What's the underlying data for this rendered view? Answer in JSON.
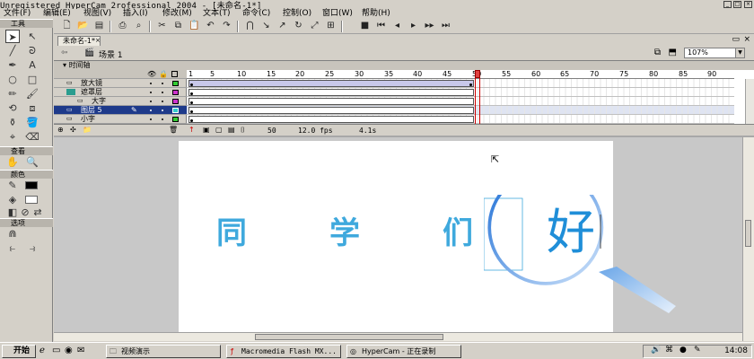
{
  "window": {
    "title": "Unregistered HyperCam 2rofessional 2004 - [未命名-1*]"
  },
  "menu": [
    "文件(F)",
    "编辑(E)",
    "视图(V)",
    "插入(I)",
    "修改(M)",
    "文本(T)",
    "命令(C)",
    "控制(O)",
    "窗口(W)",
    "帮助(H)"
  ],
  "tools": {
    "panel_tools": "工具",
    "panel_view": "查看",
    "panel_colors": "颜色",
    "panel_options": "选项"
  },
  "document": {
    "tab": "未命名-1*",
    "scene": "场景 1",
    "zoom": "107%"
  },
  "timeline": {
    "header": "时间轴",
    "ruler": [
      "1",
      "5",
      "10",
      "15",
      "20",
      "25",
      "30",
      "35",
      "40",
      "45",
      "50",
      "55",
      "60",
      "65",
      "70",
      "75",
      "80",
      "85",
      "90"
    ],
    "layers": [
      {
        "name": "放大镜",
        "color": "#33cc33",
        "selected": false
      },
      {
        "name": "遮罩层",
        "color": "#cc33cc",
        "selected": false
      },
      {
        "name": "大字",
        "color": "#cc33cc",
        "selected": false
      },
      {
        "name": "图层 5",
        "color": "#33cccc",
        "selected": true
      },
      {
        "name": "小字",
        "color": "#33cc33",
        "selected": false
      }
    ],
    "current_frame": "50",
    "fps": "12.0 fps",
    "elapsed": "4.1s"
  },
  "stage": {
    "chars": [
      "同",
      "学",
      "们",
      "好"
    ]
  },
  "taskbar": {
    "start": "开始",
    "tasks": [
      "视频演示",
      "Macromedia Flash MX...",
      "HyperCam - 正在录制"
    ],
    "clock": "14:08"
  },
  "colors": {
    "stage_text": "#3fa9dd",
    "selected_layer": "#1e3a8a",
    "playhead": "#cc0000"
  }
}
